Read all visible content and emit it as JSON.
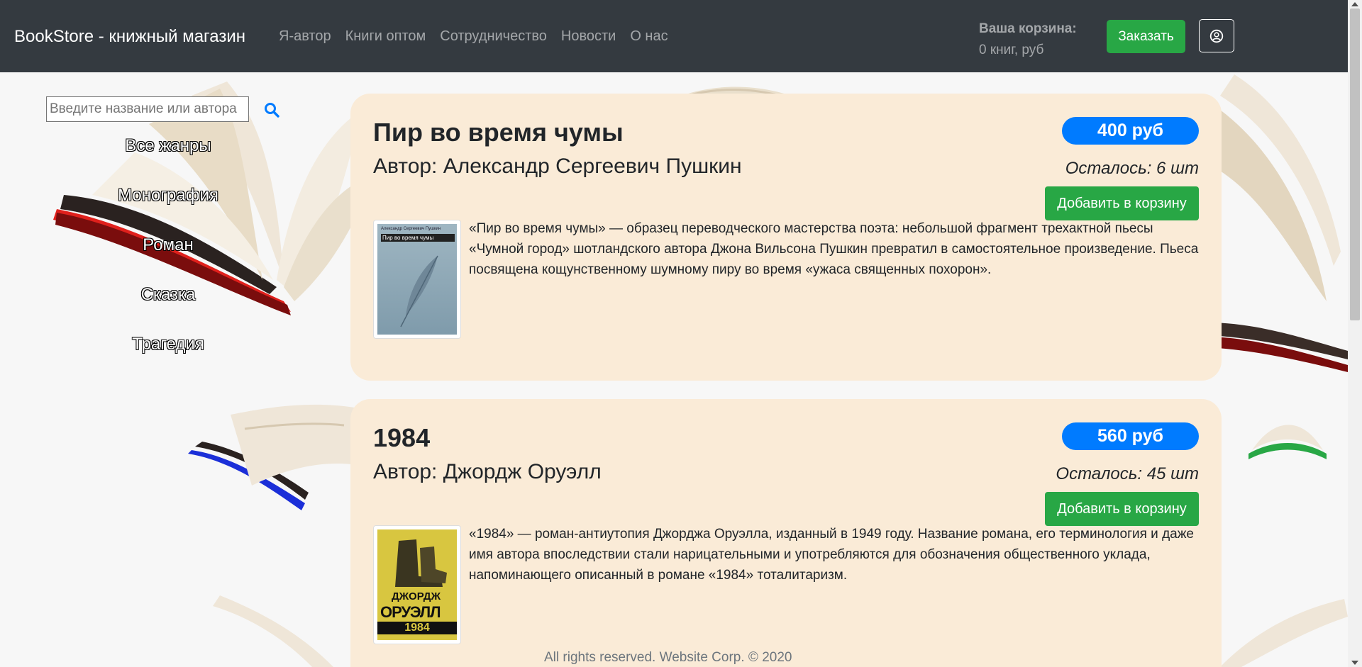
{
  "header": {
    "brand": "BookStore - книжный магазин",
    "nav": [
      "Я-автор",
      "Книги оптом",
      "Сотрудничество",
      "Новости",
      "О нас"
    ],
    "cart_title": "Ваша корзина:",
    "cart_summary": "0 книг, руб",
    "order_button": "Заказать",
    "profile_icon": "user-circle-icon"
  },
  "sidebar": {
    "search_placeholder": "Введите название или автора",
    "search_icon": "search-icon",
    "genres": [
      "Все жанры",
      "Монография",
      "Роман",
      "Сказка",
      "Трагедия"
    ]
  },
  "books": [
    {
      "title": "Пир во время чумы",
      "author": "Автор: Александр Сергеевич Пушкин",
      "price": "400 руб",
      "stock": "Осталось: 6 шт",
      "add_button": "Добавить в корзину",
      "description": "«Пир во время чумы» — образец переводческого мастерства поэта: небольшой фрагмент трехактной пьесы «Чумной город» шотландского автора Джона Вильсона Пушкин превратил в самостоятельное произведение. Пьеса посвящена кощунственному шумному пиру во время «ужаса священных похорон».",
      "cover_author": "Александр Сергеевич Пушкин",
      "cover_title": "Пир во время чумы"
    },
    {
      "title": "1984",
      "author": "Автор: Джордж Оруэлл",
      "price": "560 руб",
      "stock": "Осталось: 45 шт",
      "add_button": "Добавить в корзину",
      "description": "«1984» — роман-антиутопия Джорджа Оруэлла, изданный в 1949 году. Название романа, его терминология и даже имя автора впоследствии стали нарицательными и употребляются для обозначения общественного уклада, напоминающего описанный в романе «1984» тоталитаризм.",
      "cover_line1": "ДЖОРДЖ",
      "cover_line2": "ОРУЭЛЛ",
      "cover_line3": "1984"
    }
  ],
  "footer": "All rights reserved. Website Corp. © 2020",
  "colors": {
    "navbar": "#343a40",
    "success": "#28a745",
    "primary": "#007bff",
    "card": "#faebd7"
  }
}
